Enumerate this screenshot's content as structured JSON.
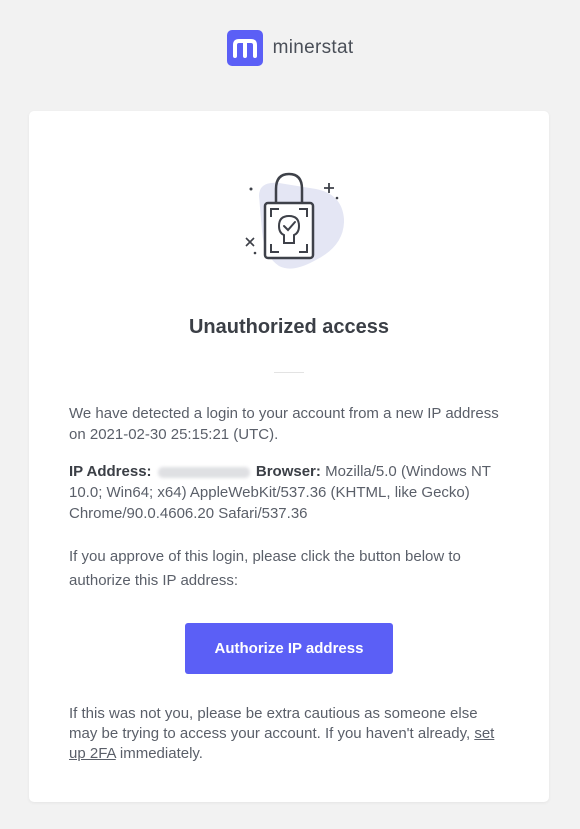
{
  "brand": {
    "name": "minerstat",
    "color": "#5b5ff6"
  },
  "email": {
    "title": "Unauthorized access",
    "detected_text": "We have detected a login to your account from a new IP address on 2021-02-30 25:15:21 (UTC).",
    "ip_label": "IP Address:",
    "browser_label": "Browser:",
    "browser_value": "Mozilla/5.0 (Windows NT 10.0; Win64; x64) AppleWebKit/537.36 (KHTML, like Gecko) Chrome/90.0.4606.20 Safari/537.36",
    "approve_text": "If you approve of this login, please click the button below to authorize this IP address:",
    "authorize_button": "Authorize IP address",
    "warning_text": "If this was not you, please be extra cautious as someone else may be trying to access your account. If you haven't already,",
    "setup_2fa_link": "set up 2FA",
    "warning_suffix": "immediately."
  },
  "icons": {
    "logo": "minerstat-logo-icon",
    "illustration": "padlock-shield-icon"
  }
}
